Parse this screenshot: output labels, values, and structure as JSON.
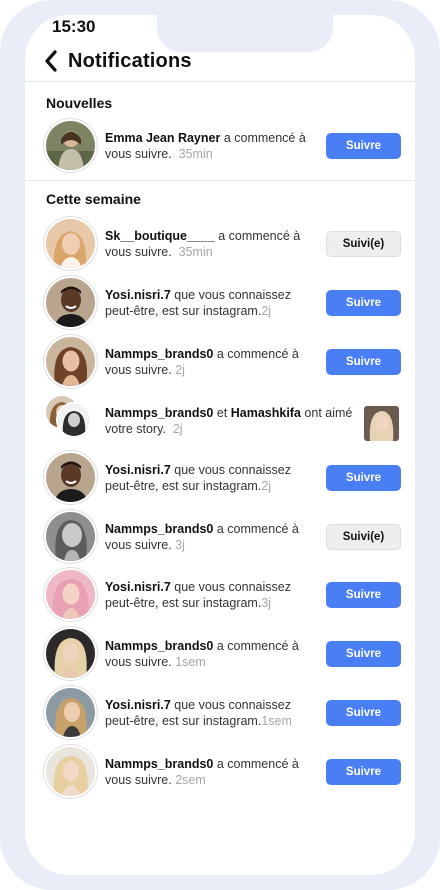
{
  "status": {
    "time": "15:30"
  },
  "header": {
    "title": "Notifications",
    "back_icon": "chevron-left-icon"
  },
  "sections": {
    "new": "Nouvelles",
    "week": "Cette semaine"
  },
  "colors": {
    "accent": "#4a7ef5",
    "frame": "#e8edf8"
  },
  "notifications": [
    {
      "user": "Emma Jean Rayner",
      "text": " a commencé à vous suivre.",
      "time": "35min",
      "button": "Suivre"
    },
    {
      "user": "Sk__boutique____",
      "text": "  a commencé à vous suivre.",
      "time": "35min",
      "button": "Suivi(e)"
    },
    {
      "user": "Yosi.nisri.7",
      "text": " que vous connaissez peut-être, est sur instagram.",
      "time": "2j",
      "button": "Suivre"
    },
    {
      "user": "Nammps_brands0",
      "text": "  a commencé à vous suivre.",
      "time": "2j",
      "button": "Suivre"
    },
    {
      "user": "Nammps_brands0",
      "mid": " et ",
      "user2": "Hamashkifa",
      "text": " ont aimé votre story.",
      "time": "2j"
    },
    {
      "user": "Yosi.nisri.7",
      "text": " que vous connaissez peut-être, est sur instagram.",
      "time": "2j",
      "button": "Suivre"
    },
    {
      "user": "Nammps_brands0",
      "text": "  a commencé à vous suivre.",
      "time": "3j",
      "button": "Suivi(e)"
    },
    {
      "user": "Yosi.nisri.7",
      "text": " que vous connaissez peut-être, est sur instagram.",
      "time": "3j",
      "button": "Suivre"
    },
    {
      "user": "Nammps_brands0",
      "text": "  a commencé à vous suivre.",
      "time": "1sem",
      "button": "Suivre"
    },
    {
      "user": "Yosi.nisri.7",
      "text": " que vous connaissez peut-être, est sur instagram.",
      "time": "1sem",
      "button": "Suivre"
    },
    {
      "user": "Nammps_brands0",
      "text": "  a commencé à vous suivre.",
      "time": "2sem",
      "button": "Suivre"
    }
  ]
}
